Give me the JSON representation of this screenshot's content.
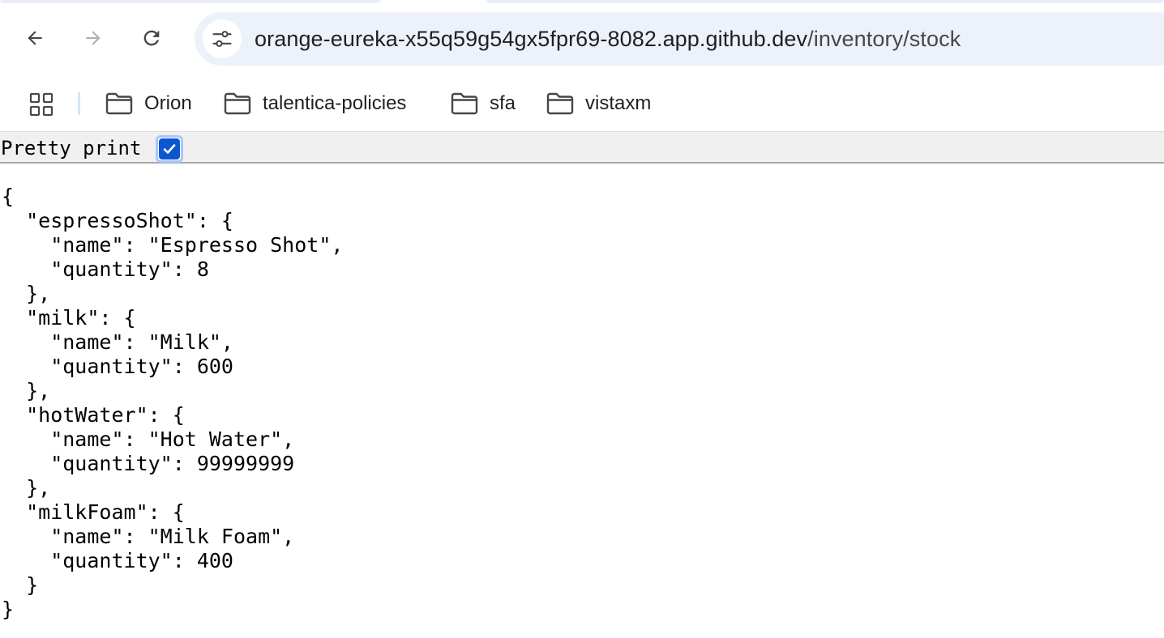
{
  "browser": {
    "url_host": "orange-eureka-x55q59g54gx5fpr69-8082.app.github.dev",
    "url_path": "/inventory/stock",
    "icons": {
      "back": "arrow-left-icon",
      "forward": "arrow-right-icon",
      "reload": "reload-icon",
      "site_info": "tune-icon",
      "apps": "grid-icon",
      "folder": "folder-icon"
    }
  },
  "bookmarks": {
    "items": [
      {
        "label": "Orion"
      },
      {
        "label": "talentica-policies"
      },
      {
        "label": "sfa"
      },
      {
        "label": "vistaxm"
      }
    ]
  },
  "viewer": {
    "pretty_print_label": "Pretty print",
    "pretty_print_checked": true,
    "json_text": "{\n  \"espressoShot\": {\n    \"name\": \"Espresso Shot\",\n    \"quantity\": 8\n  },\n  \"milk\": {\n    \"name\": \"Milk\",\n    \"quantity\": 600\n  },\n  \"hotWater\": {\n    \"name\": \"Hot Water\",\n    \"quantity\": 99999999\n  },\n  \"milkFoam\": {\n    \"name\": \"Milk Foam\",\n    \"quantity\": 400\n  }\n}"
  },
  "colors": {
    "omnibox_bg": "#edf2fa",
    "checkbox_accent": "#0b57d0",
    "text": "#1f1f1f"
  }
}
